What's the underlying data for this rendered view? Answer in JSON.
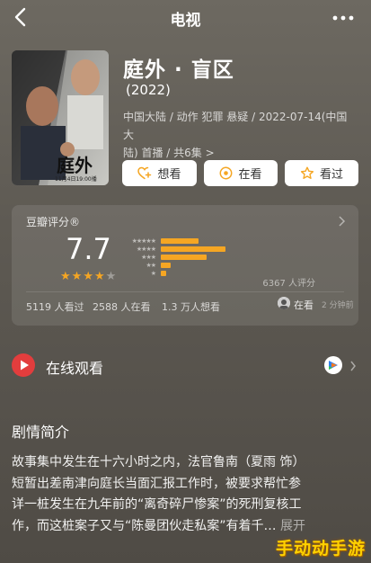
{
  "header": {
    "title": "电视",
    "back_icon": "back-chevron-icon",
    "more_icon": "more-dots-icon"
  },
  "movie": {
    "title": "庭外 · 盲区",
    "year": "(2022)",
    "meta_line1": "中国大陆 / 动作 犯罪 悬疑 / 2022-07-14(中国大",
    "meta_line2": "陆) 首播 / 共6集 >",
    "poster": {
      "title_text": "庭外",
      "date_text": "11月4日19:00播"
    }
  },
  "actions": {
    "want": "想看",
    "watching": "在看",
    "watched": "看过"
  },
  "rating": {
    "label": "豆瓣评分®",
    "score": "7.7",
    "star_count": 4,
    "distribution": [
      {
        "stars": 5,
        "fraction": 0.22
      },
      {
        "stars": 4,
        "fraction": 0.38
      },
      {
        "stars": 3,
        "fraction": 0.27
      },
      {
        "stars": 2,
        "fraction": 0.06
      },
      {
        "stars": 1,
        "fraction": 0.03
      }
    ],
    "count_text": "6367 人评分",
    "watched_text": "5119 人看过",
    "watching_text": "2588 人在看",
    "want_text": "1.3 万人想看",
    "friend_watching": "在看",
    "friend_time": "2 分钟前"
  },
  "watch_online": {
    "label": "在线观看",
    "platform_icon": "tencent-video-icon"
  },
  "synopsis": {
    "title": "剧情简介",
    "line1": "故事集中发生在十六小时之内，法官鲁南（夏雨 饰）",
    "line2": "短暂出差南津向庭长当面汇报工作时，被要求帮忙参",
    "line3": "详一桩发生在九年前的“离奇碎尸惨案”的死刑复核工",
    "line4": "作，而这桩案子又与“陈曼团伙走私案”有着千… ",
    "expand": "展开"
  },
  "watermark": "手动动手游",
  "colors": {
    "accent": "#f5a623",
    "play_red": "#e23d3d",
    "background": "#5e5a53"
  }
}
